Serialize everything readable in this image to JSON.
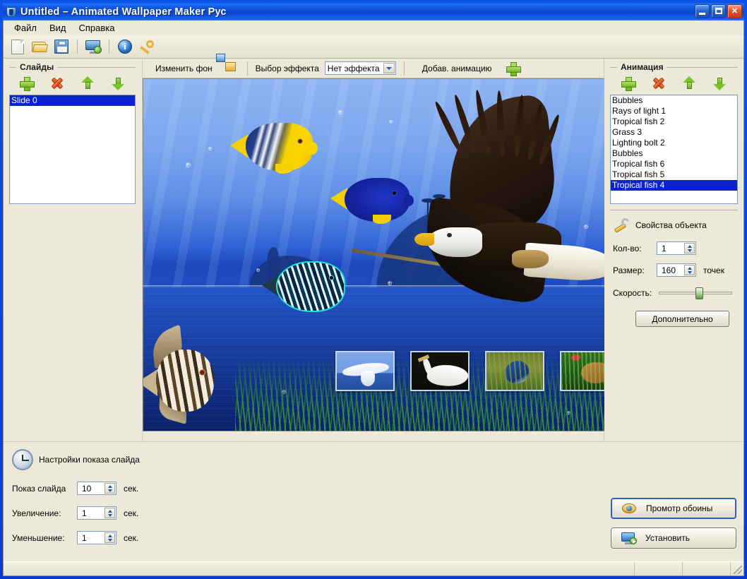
{
  "window": {
    "title": "Untitled – Animated Wallpaper Maker Рус",
    "icon": "app-shield-icon",
    "controls": {
      "minimize": "minimize-button",
      "maximize": "maximize-button",
      "close": "close-button"
    }
  },
  "menu": {
    "items": [
      "Файл",
      "Вид",
      "Справка"
    ]
  },
  "toolbar": {
    "buttons": [
      {
        "name": "new-file-button",
        "icon": "new-document-icon"
      },
      {
        "name": "open-file-button",
        "icon": "open-folder-icon"
      },
      {
        "name": "save-file-button",
        "icon": "floppy-save-icon"
      },
      {
        "name": "apply-wallpaper-button",
        "icon": "monitor-play-icon"
      },
      {
        "name": "about-button",
        "icon": "info-circle-icon"
      },
      {
        "name": "register-button",
        "icon": "key-icon"
      }
    ]
  },
  "slides_panel": {
    "title": "Слайды",
    "buttons": [
      "add-slide",
      "delete-slide",
      "move-slide-up",
      "move-slide-down"
    ],
    "items": [
      "Slide 0"
    ],
    "selected_index": 0
  },
  "scene_toolbar": {
    "change_background_label": "Изменить фон",
    "change_background_icon": "picture-swap-icon",
    "effect_label": "Выбор эффекта",
    "effect_value": "Нет эффекта",
    "effect_options": [
      "Нет эффекта"
    ],
    "add_animation_label": "Добав. анимацию",
    "add_animation_icon": "green-plus-icon"
  },
  "preview": {
    "alt": "Underwater blue scene with tropical fish, a flying bald eagle and four bird photo thumbnails over grass"
  },
  "animation_panel": {
    "title": "Анимация",
    "buttons": [
      "add-animation",
      "delete-animation",
      "move-animation-up",
      "move-animation-down"
    ],
    "items": [
      "Bubbles",
      "Rays of light 1",
      "Tropical fish 2",
      "Grass 3",
      "Lighting bolt 2",
      "Bubbles",
      "Tropical fish 6",
      "Tropical fish 5",
      "Tropical fish 4"
    ],
    "selected_index": 8
  },
  "object_properties": {
    "title": "Свойства объекта",
    "icon": "wrench-icon",
    "count_label": "Кол-во:",
    "count_value": "1",
    "size_label": "Размер:",
    "size_value": "160",
    "size_unit": "точек",
    "speed_label": "Скорость:",
    "speed_percent": 52,
    "more_button": "Дополнительно"
  },
  "slide_settings": {
    "title": "Настройки показа слайда",
    "icon": "clock-icon",
    "fields": [
      {
        "label": "Показ слайда",
        "value": "10",
        "unit": "сек."
      },
      {
        "label": "Увеличение:",
        "value": "1",
        "unit": "сек."
      },
      {
        "label": "Уменьшение:",
        "value": "1",
        "unit": "сек."
      }
    ]
  },
  "actions": {
    "preview_button": {
      "label": "Промотр обоины",
      "icon": "eye-icon"
    },
    "install_button": {
      "label": "Установить",
      "icon": "monitor-install-icon"
    }
  },
  "statusbar": {
    "main": "",
    "panel1": "",
    "panel2": ""
  },
  "colors": {
    "titlebar_blue": "#0b47cf",
    "window_face": "#ece9d8",
    "selection_blue": "#0a24c8",
    "accent_green": "#7cc32b",
    "accent_red": "#d6420c"
  }
}
